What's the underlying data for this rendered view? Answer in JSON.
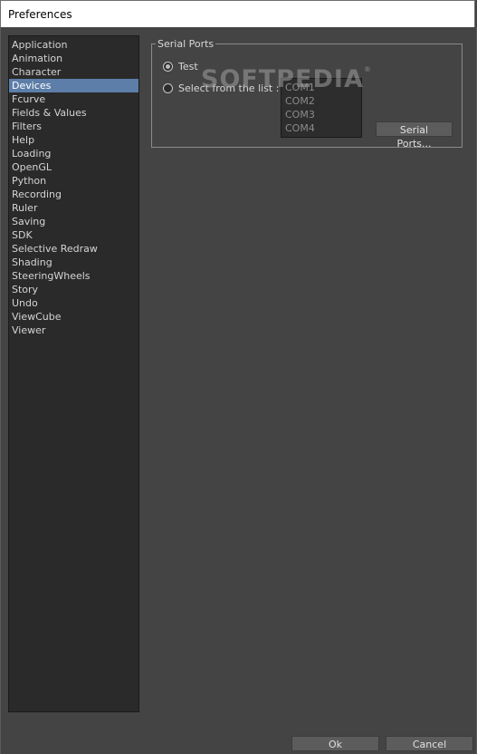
{
  "window": {
    "title": "Preferences"
  },
  "sidebar": {
    "items": [
      {
        "label": "Application"
      },
      {
        "label": "Animation"
      },
      {
        "label": "Character"
      },
      {
        "label": "Devices"
      },
      {
        "label": "Fcurve"
      },
      {
        "label": "Fields & Values"
      },
      {
        "label": "Filters"
      },
      {
        "label": "Help"
      },
      {
        "label": "Loading"
      },
      {
        "label": "OpenGL"
      },
      {
        "label": "Python"
      },
      {
        "label": "Recording"
      },
      {
        "label": "Ruler"
      },
      {
        "label": "Saving"
      },
      {
        "label": "SDK"
      },
      {
        "label": "Selective Redraw"
      },
      {
        "label": "Shading"
      },
      {
        "label": "SteeringWheels"
      },
      {
        "label": "Story"
      },
      {
        "label": "Undo"
      },
      {
        "label": "ViewCube"
      },
      {
        "label": "Viewer"
      }
    ],
    "selected": "Devices"
  },
  "serial_ports": {
    "group_title": "Serial Ports",
    "option_test": "Test",
    "option_select": "Select from the list :",
    "selected_option": "Test",
    "ports": [
      "COM1",
      "COM2",
      "COM3",
      "COM4"
    ],
    "serial_ports_button": "Serial Ports..."
  },
  "watermark": {
    "text": "SOFTPEDIA",
    "mark": "®"
  },
  "footer": {
    "ok_label": "Ok",
    "cancel_label": "Cancel"
  },
  "colors": {
    "selection": "#5d7ea8",
    "background": "#444444",
    "list_bg": "#2a2a2a"
  }
}
